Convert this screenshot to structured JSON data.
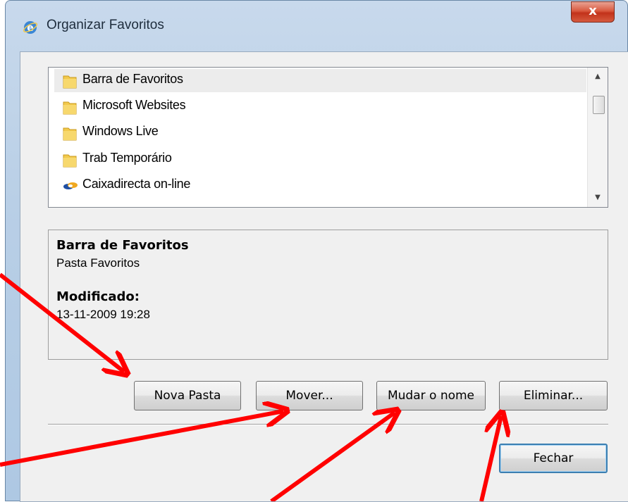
{
  "window": {
    "title": "Organizar Favoritos",
    "close_label": "x"
  },
  "list": {
    "items": [
      {
        "label": "Barra de Favoritos",
        "icon": "folder-icon",
        "selected": true
      },
      {
        "label": "Microsoft Websites",
        "icon": "folder-icon",
        "selected": false
      },
      {
        "label": "Windows Live",
        "icon": "folder-icon",
        "selected": false
      },
      {
        "label": "Trab Temporário",
        "icon": "folder-icon",
        "selected": false
      },
      {
        "label": "Caixadirecta on-line",
        "icon": "link-icon",
        "selected": false
      }
    ]
  },
  "details": {
    "name": "Barra de Favoritos",
    "type": "Pasta Favoritos",
    "modified_label": "Modificado:",
    "modified_value": "13-11-2009 19:28"
  },
  "buttons": {
    "new_folder": "Nova Pasta",
    "move": "Mover...",
    "rename": "Mudar o nome",
    "delete": "Eliminar...",
    "close": "Fechar"
  },
  "colors": {
    "annotation_arrow": "#ff0000",
    "folder": "#f2c94c",
    "close_button": "#c8432b"
  }
}
